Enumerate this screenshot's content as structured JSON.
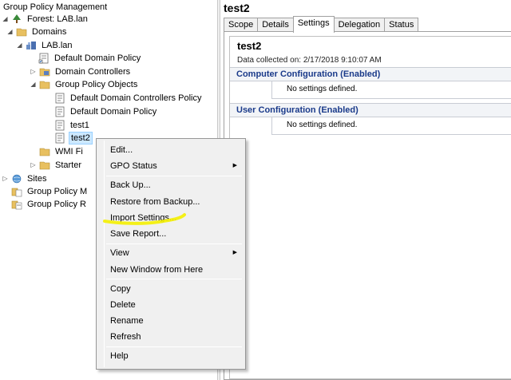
{
  "tree": {
    "items": [
      {
        "label": "Group Policy Management",
        "icon": "gpm-icon",
        "expander": ""
      },
      {
        "label": "Forest: LAB.lan",
        "icon": "forest-icon",
        "expander": "expanded"
      },
      {
        "label": "Domains",
        "icon": "folder-icon",
        "expander": "expanded"
      },
      {
        "label": "LAB.lan",
        "icon": "domain-icon",
        "expander": "expanded"
      },
      {
        "label": "Default Domain Policy",
        "icon": "gpo-link-icon",
        "expander": ""
      },
      {
        "label": "Domain Controllers",
        "icon": "ou-icon",
        "expander": "collapsed"
      },
      {
        "label": "Group Policy Objects",
        "icon": "folder-icon",
        "expander": "expanded"
      },
      {
        "label": "Default Domain Controllers Policy",
        "icon": "gpo-icon",
        "expander": ""
      },
      {
        "label": "Default Domain Policy",
        "icon": "gpo-icon",
        "expander": ""
      },
      {
        "label": "test1",
        "icon": "gpo-icon",
        "expander": ""
      },
      {
        "label": "test2",
        "icon": "gpo-icon",
        "expander": ""
      },
      {
        "label": "WMI Fi",
        "icon": "folder-icon",
        "expander": ""
      },
      {
        "label": "Starter",
        "icon": "folder-icon",
        "expander": "collapsed"
      },
      {
        "label": "Sites",
        "icon": "sites-icon",
        "expander": "collapsed"
      },
      {
        "label": "Group Policy M",
        "icon": "modeling-icon",
        "expander": ""
      },
      {
        "label": "Group Policy R",
        "icon": "results-icon",
        "expander": ""
      }
    ]
  },
  "details": {
    "title": "test2",
    "tabs": [
      "Scope",
      "Details",
      "Settings",
      "Delegation",
      "Status"
    ],
    "active_tab": "Settings",
    "report": {
      "name": "test2",
      "collected": "Data collected on: 2/17/2018 9:10:07 AM",
      "computer_header": "Computer Configuration (Enabled)",
      "computer_body": "No settings defined.",
      "user_header": "User Configuration (Enabled)",
      "user_body": "No settings defined."
    }
  },
  "context_menu": {
    "items": [
      {
        "label": "Edit...",
        "submenu": false
      },
      {
        "label": "GPO Status",
        "submenu": true
      },
      {
        "label": "Back Up...",
        "submenu": false
      },
      {
        "label": "Restore from Backup...",
        "submenu": false
      },
      {
        "label": "Import Settings...",
        "submenu": false,
        "highlighted": true
      },
      {
        "label": "Save Report...",
        "submenu": false
      },
      {
        "label": "View",
        "submenu": true
      },
      {
        "label": "New Window from Here",
        "submenu": false
      },
      {
        "label": "Copy",
        "submenu": false
      },
      {
        "label": "Delete",
        "submenu": false
      },
      {
        "label": "Rename",
        "submenu": false
      },
      {
        "label": "Refresh",
        "submenu": false
      },
      {
        "label": "Help",
        "submenu": false
      }
    ],
    "highlight_color": "#f4f000"
  },
  "colors": {
    "selection_bg": "#cce8ff",
    "section_header_text": "#1a3a8a"
  }
}
